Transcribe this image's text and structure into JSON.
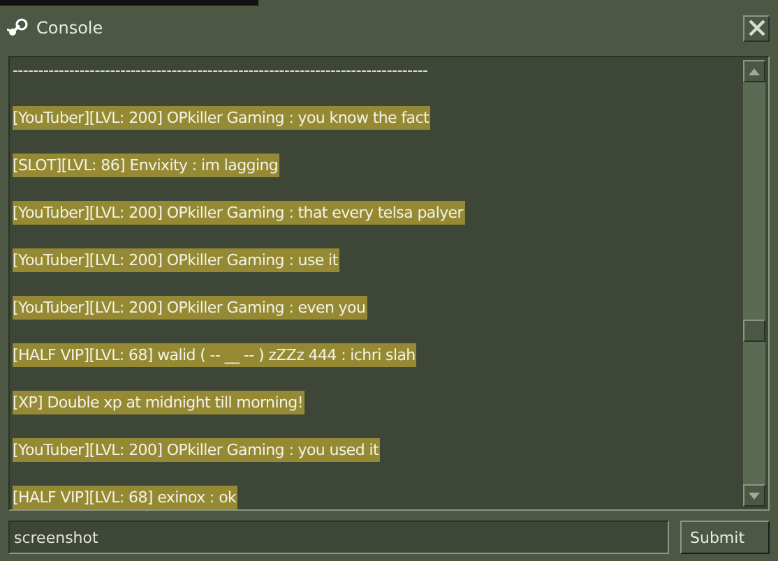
{
  "window": {
    "title": "Console"
  },
  "lines": [
    {
      "text": "---------------------------------------------------------------------------------",
      "highlighted": false
    },
    {
      "text": "[YouTuber][LVL: 200] OPkiller Gaming : you know the fact",
      "highlighted": true
    },
    {
      "text": "[SLOT][LVL: 86] Envixity : im lagging",
      "highlighted": true
    },
    {
      "text": "[YouTuber][LVL: 200] OPkiller Gaming : that every telsa palyer",
      "highlighted": true
    },
    {
      "text": "[YouTuber][LVL: 200] OPkiller Gaming : use it",
      "highlighted": true
    },
    {
      "text": "[YouTuber][LVL: 200] OPkiller Gaming : even you",
      "highlighted": true
    },
    {
      "text": "[HALF VIP][LVL: 68] walid ( -- __ -- ) zZZz 444 : ichri slah",
      "highlighted": true
    },
    {
      "text": "[XP] Double xp at midnight till morning!",
      "highlighted": true
    },
    {
      "text": "[YouTuber][LVL: 200] OPkiller Gaming : you used it",
      "highlighted": true
    },
    {
      "text": "[HALF VIP][LVL: 68] exinox : ok",
      "highlighted": true
    }
  ],
  "input": {
    "value": "screenshot "
  },
  "buttons": [
    "Submit"
  ]
}
